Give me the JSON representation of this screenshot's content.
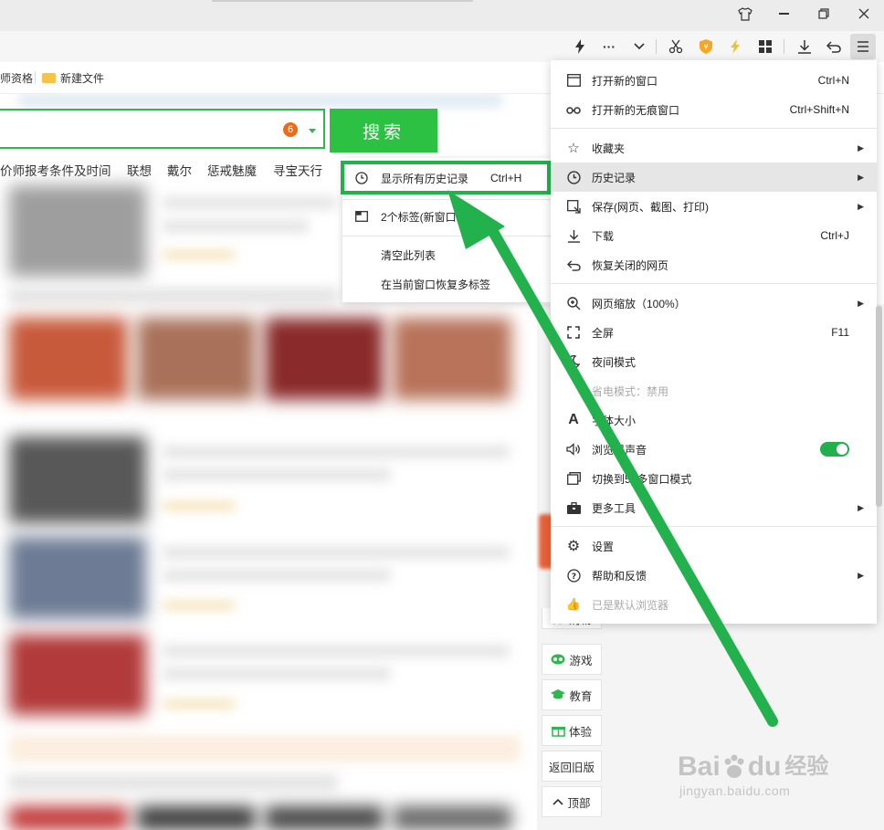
{
  "titlebar": {
    "icons": [
      "shirt-icon",
      "minimize-icon",
      "restore-icon",
      "close-icon"
    ]
  },
  "toolbar": {
    "icons": [
      "lightning-icon",
      "more-icon",
      "chevron-down-icon",
      "scissors-icon",
      "shield-icon",
      "bolt-icon",
      "apps-icon",
      "download-icon",
      "undo-icon",
      "menu-icon"
    ]
  },
  "bookmarks": {
    "item1": "师资格",
    "item2": "新建文件"
  },
  "search": {
    "badge": "6",
    "button": "搜索"
  },
  "hot_words": [
    "价师报考条件及时间",
    "联想",
    "戴尔",
    "惩戒魅魔",
    "寻宝天行"
  ],
  "side_tiles": [
    "游戏",
    "教育",
    "体验",
    "返回旧版",
    "顶部"
  ],
  "side_partial": "购物",
  "history_submenu": [
    {
      "label": "显示所有历史记录",
      "shortcut": "Ctrl+H"
    },
    {
      "label": "2个标签(新窗口"
    },
    {
      "label": "清空此列表"
    },
    {
      "label": "在当前窗口恢复多标签"
    }
  ],
  "menu": {
    "items": [
      {
        "label": "打开新的窗口",
        "shortcut": "Ctrl+N",
        "icon": "window-icon"
      },
      {
        "label": "打开新的无痕窗口",
        "shortcut": "Ctrl+Shift+N",
        "icon": "incognito-icon"
      },
      {
        "label": "收藏夹",
        "icon": "star-list-icon"
      },
      {
        "label": "历史记录",
        "icon": "clock-icon"
      },
      {
        "label": "保存(网页、截图、打印)",
        "icon": "save-icon"
      },
      {
        "label": "下载",
        "shortcut": "Ctrl+J",
        "icon": "download-icon"
      },
      {
        "label": "恢复关闭的网页",
        "icon": "restore-icon"
      },
      {
        "label": "网页缩放（100%）",
        "icon": "zoom-icon"
      },
      {
        "label": "全屏",
        "shortcut": "F11",
        "icon": "fullscreen-icon"
      },
      {
        "label": "夜间模式",
        "icon": "moon-icon"
      },
      {
        "label": "省电模式：禁用",
        "icon": "leaf-icon"
      },
      {
        "label": "字体大小",
        "icon": "font-icon"
      },
      {
        "label": "浏览器声音",
        "icon": "speaker-icon"
      },
      {
        "label": "切换到56多窗口模式",
        "icon": "multiwindow-icon"
      },
      {
        "label": "更多工具",
        "icon": "toolbox-icon"
      },
      {
        "label": "设置",
        "icon": "gear-icon"
      },
      {
        "label": "帮助和反馈",
        "icon": "help-icon"
      },
      {
        "label": "已是默认浏览器",
        "icon": "thumb-icon"
      }
    ]
  },
  "watermark": {
    "brand": "Bai",
    "brand2": "du",
    "cn": "经验",
    "url": "jingyan.baidu.com"
  },
  "colors": {
    "accent": "#22b24c",
    "search_button": "#2cc143",
    "badge": "#f06a15"
  }
}
